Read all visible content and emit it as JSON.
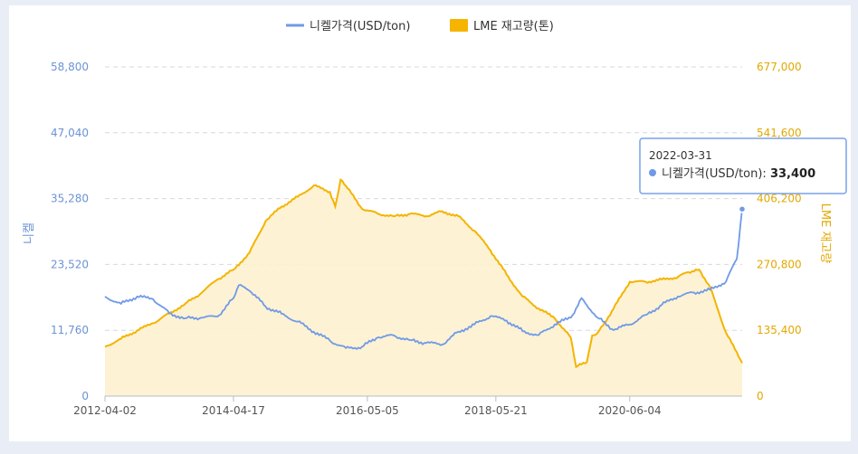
{
  "chart_data": {
    "type": "line",
    "legend": {
      "position": "top-center",
      "entries": [
        "니켈가격(USD/ton)",
        "LME 재고량(톤)"
      ]
    },
    "x_start": "2012-04-02",
    "x_end": "2022-03-31",
    "x_tick_labels": [
      "2012-04-02",
      "2014-04-17",
      "2016-05-05",
      "2018-05-21",
      "2020-06-04"
    ],
    "y_left": {
      "label": "니켈",
      "ylim": [
        0,
        58800
      ],
      "ticks": [
        "0",
        "11,760",
        "23,520",
        "35,280",
        "47,040",
        "58,800"
      ]
    },
    "y_right": {
      "label": "LME 재고량",
      "ylim": [
        0,
        677000
      ],
      "ticks": [
        "0",
        "135,400",
        "270,800",
        "406,200",
        "541,600",
        "677,000"
      ]
    },
    "grid": "horizontal dashed",
    "series": [
      {
        "name": "니켈가격(USD/ton)",
        "axis": "left",
        "color": "#6f9ae6",
        "x": [
          "2012-04",
          "2012-07",
          "2012-10",
          "2013-01",
          "2013-04",
          "2013-07",
          "2013-10",
          "2014-01",
          "2014-04",
          "2014-05",
          "2014-07",
          "2014-10",
          "2015-01",
          "2015-04",
          "2015-07",
          "2015-10",
          "2016-01",
          "2016-04",
          "2016-07",
          "2016-10",
          "2017-01",
          "2017-04",
          "2017-07",
          "2017-10",
          "2018-01",
          "2018-04",
          "2018-07",
          "2018-10",
          "2019-01",
          "2019-04",
          "2019-07",
          "2019-09",
          "2019-12",
          "2020-03",
          "2020-06",
          "2020-09",
          "2020-12",
          "2021-03",
          "2021-06",
          "2021-09",
          "2021-12",
          "2022-02",
          "2022-03"
        ],
        "values": [
          17800,
          16500,
          17800,
          17300,
          14800,
          13900,
          14000,
          14200,
          17500,
          19800,
          18800,
          16000,
          14700,
          13300,
          11500,
          9900,
          8600,
          8800,
          10500,
          10800,
          10000,
          9500,
          9200,
          11500,
          12800,
          14300,
          13500,
          11600,
          10900,
          12800,
          14000,
          17500,
          14000,
          11800,
          12800,
          14500,
          16300,
          17800,
          18500,
          19000,
          20500,
          24500,
          33400
        ]
      },
      {
        "name": "LME 재고량(톤)",
        "axis": "right",
        "color": "#f4b400",
        "x": [
          "2012-04",
          "2012-07",
          "2012-10",
          "2013-01",
          "2013-04",
          "2013-07",
          "2013-10",
          "2014-01",
          "2014-04",
          "2014-07",
          "2014-10",
          "2015-01",
          "2015-04",
          "2015-07",
          "2015-10",
          "2015-11",
          "2015-12",
          "2016-01",
          "2016-04",
          "2016-07",
          "2016-10",
          "2017-01",
          "2017-04",
          "2017-07",
          "2017-10",
          "2018-01",
          "2018-04",
          "2018-07",
          "2018-10",
          "2019-01",
          "2019-04",
          "2019-07",
          "2019-08",
          "2019-10",
          "2019-11",
          "2019-12",
          "2020-03",
          "2020-06",
          "2020-09",
          "2020-12",
          "2021-03",
          "2021-05",
          "2021-07",
          "2021-09",
          "2021-12",
          "2022-03"
        ],
        "values": [
          102000,
          118000,
          135000,
          150000,
          170000,
          190000,
          212000,
          240000,
          260000,
          295000,
          360000,
          390000,
          410000,
          433000,
          420000,
          390000,
          445000,
          432000,
          385000,
          375000,
          370000,
          375000,
          370000,
          380000,
          370000,
          340000,
          300000,
          250000,
          205000,
          180000,
          160000,
          120000,
          60000,
          70000,
          125000,
          130000,
          180000,
          235000,
          235000,
          240000,
          245000,
          255000,
          260000,
          225000,
          130000,
          68000
        ]
      }
    ],
    "tooltip": {
      "date": "2022-03-31",
      "series": "니켈가격(USD/ton)",
      "label": "니켈가격(USD/ton): ",
      "value": "33,400"
    }
  }
}
